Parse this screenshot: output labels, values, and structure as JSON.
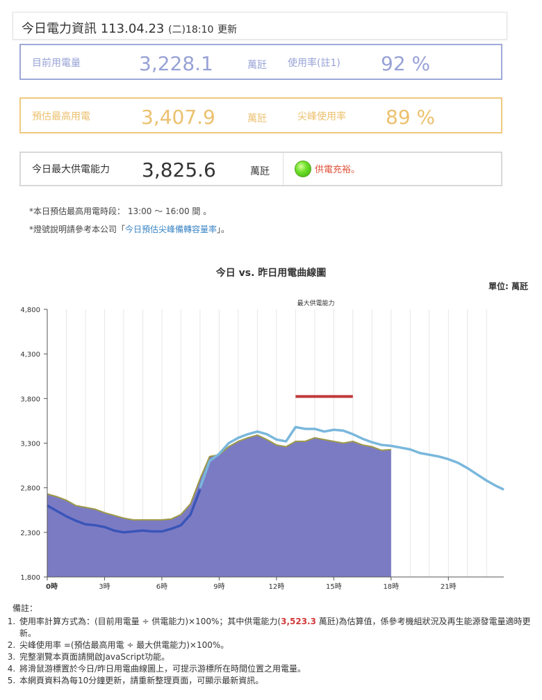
{
  "header": {
    "title": "今日電力資訊",
    "date": "113.04.23",
    "weekday": "(二)",
    "time": "18:10",
    "update": "更新"
  },
  "current": {
    "label": "目前用電量",
    "value": "3,228.1",
    "unit": "萬瓩",
    "rate_label": "使用率(註1)",
    "rate": "92 %"
  },
  "peak": {
    "label": "預估最高用電",
    "value": "3,407.9",
    "unit": "萬瓩",
    "rate_label": "尖峰使用率",
    "rate": "89 %"
  },
  "supply": {
    "label": "今日最大供電能力",
    "value": "3,825.6",
    "unit": "萬瓩",
    "status": "供電充裕。"
  },
  "notes": {
    "n1": "*本日預估最高用電時段： 13:00 ～ 16:00 間  。",
    "n2_pre": "*燈號說明請參考本公司「",
    "n2_link": "今日預估尖峰備轉容量率",
    "n2_post": "」。"
  },
  "chart_title": "今日 vs. 昨日用電曲線圖",
  "chart_unit": "單位: 萬瓩",
  "chart_data": {
    "type": "area",
    "y_ticks": [
      "1,800",
      "2,300",
      "2,800",
      "3,300",
      "3,800",
      "4,300",
      "4,800"
    ],
    "ylim": [
      1800,
      4800
    ],
    "x_ticks": [
      "0時",
      "3時",
      "6時",
      "9時",
      "12時",
      "15時",
      "18時",
      "21時"
    ],
    "xlim": [
      0,
      23.9
    ],
    "annotation": "最大供電能力",
    "capacity": {
      "value": 3823,
      "x_start": 13,
      "x_end": 16,
      "color": "#c0393b"
    },
    "series": [
      {
        "role": "today_area",
        "color": "#7b7bc4",
        "x": [
          0,
          0.5,
          1,
          1.5,
          2,
          2.5,
          3,
          3.5,
          4,
          4.5,
          5,
          5.5,
          6,
          6.5,
          7,
          7.5,
          8,
          8.5,
          9,
          9.5,
          10,
          10.5,
          11,
          11.5,
          12,
          12.5,
          13,
          13.5,
          14,
          14.5,
          15,
          15.5,
          16,
          16.5,
          17,
          17.5,
          18
        ],
        "y": [
          2730,
          2700,
          2660,
          2600,
          2580,
          2560,
          2520,
          2490,
          2460,
          2440,
          2440,
          2440,
          2440,
          2450,
          2500,
          2620,
          2900,
          3150,
          3170,
          3260,
          3320,
          3360,
          3390,
          3340,
          3280,
          3260,
          3320,
          3320,
          3360,
          3340,
          3320,
          3300,
          3320,
          3280,
          3260,
          3220,
          3228
        ]
      },
      {
        "role": "today_line",
        "color": "#3a55b8",
        "x": [
          0,
          0.5,
          1,
          1.5,
          2,
          2.5,
          3,
          3.5,
          4,
          4.5,
          5,
          5.5,
          6,
          6.5,
          7,
          7.5,
          8
        ],
        "y": [
          2600,
          2540,
          2480,
          2430,
          2390,
          2380,
          2360,
          2320,
          2300,
          2310,
          2320,
          2310,
          2310,
          2340,
          2380,
          2500,
          2780
        ]
      },
      {
        "role": "yesterday",
        "color": "#79b7dc",
        "x": [
          8,
          8.5,
          9,
          9.5,
          10,
          10.5,
          11,
          11.5,
          12,
          12.5,
          13,
          13.5,
          14,
          14.5,
          15,
          15.5,
          16,
          16.5,
          17,
          17.5,
          18,
          18.5,
          19,
          19.5,
          20,
          20.5,
          21,
          21.5,
          22,
          22.5,
          23,
          23.5,
          23.9
        ],
        "y": [
          2800,
          3100,
          3180,
          3300,
          3360,
          3400,
          3430,
          3400,
          3340,
          3320,
          3480,
          3460,
          3460,
          3430,
          3450,
          3440,
          3400,
          3350,
          3310,
          3280,
          3270,
          3250,
          3230,
          3190,
          3170,
          3150,
          3120,
          3080,
          3020,
          2950,
          2880,
          2820,
          2780
        ]
      }
    ]
  },
  "remarks_title": "備註：",
  "remarks": {
    "r1_pre": "使用率計算方式為：(目前用電量 ÷ 供電能力)×100%；其中供電能力(",
    "r1_val": "3,523.3",
    "r1_post": " 萬瓩)為估算值，係參考機組狀況及再生能源發電量適時更新。",
    "r2": "尖峰使用率 =(預估最高用電 ÷ 最大供電能力)×100%。",
    "r3": "完整瀏覽本頁面請開啟JavaScript功能。",
    "r4": "將滑鼠游標置於今日/昨日用電曲線圖上，可提示游標所在時間位置之用電量。",
    "r5": "本網頁資料為每10分鐘更新，請重新整理頁面，可顯示最新資訊。"
  }
}
